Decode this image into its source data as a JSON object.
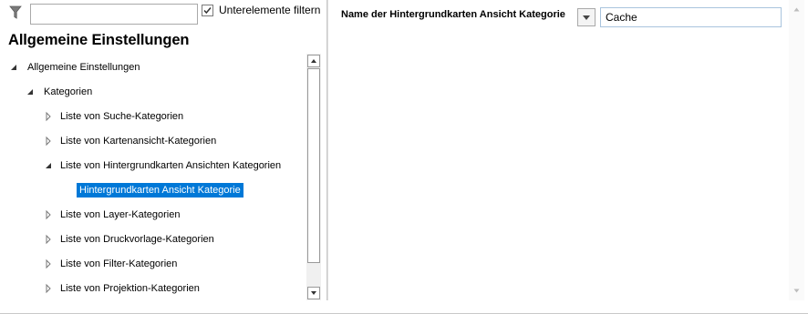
{
  "filter": {
    "placeholder": "",
    "value": "",
    "checkbox_label": "Unterelemente filtern",
    "checkbox_checked": true
  },
  "left": {
    "section_title": "Allgemeine Einstellungen"
  },
  "tree": {
    "nodes": [
      {
        "label": "Allgemeine Einstellungen",
        "expanded": true
      },
      {
        "label": "Kategorien",
        "expanded": true
      },
      {
        "label": "Liste von Suche-Kategorien",
        "expanded": false
      },
      {
        "label": "Liste von Kartenansicht-Kategorien",
        "expanded": false
      },
      {
        "label": "Liste von Hintergrundkarten Ansichten Kategorien",
        "expanded": true
      },
      {
        "label": "Hintergrundkarten Ansicht Kategorie",
        "selected": true
      },
      {
        "label": "Liste von Layer-Kategorien",
        "expanded": false
      },
      {
        "label": "Liste von Druckvorlage-Kategorien",
        "expanded": false
      },
      {
        "label": "Liste von Filter-Kategorien",
        "expanded": false
      },
      {
        "label": "Liste von Projektion-Kategorien",
        "expanded": false
      }
    ]
  },
  "property": {
    "label": "Name der Hintergrundkarten Ansicht Kategorie",
    "value": "Cache"
  },
  "colors": {
    "selection": "#0078d7",
    "selection_text": "#ffffff"
  },
  "icons": {
    "filter": "funnel-icon",
    "expanded": "triangle-filled-icon",
    "collapsed": "triangle-outline-icon",
    "scroll_up": "scroll-up-arrow-icon",
    "scroll_down": "scroll-down-arrow-icon",
    "dropdown": "dropdown-arrow-icon"
  }
}
